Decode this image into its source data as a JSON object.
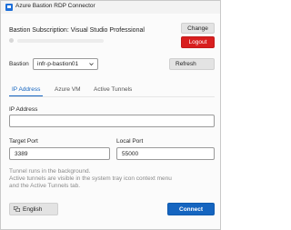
{
  "window": {
    "title": "Azure Bastion RDP Connector"
  },
  "subscription": {
    "prefix": "Bastion Subscription:",
    "name": "Visual Studio Professional"
  },
  "buttons": {
    "change": "Change",
    "logout": "Logout",
    "refresh": "Refresh",
    "connect": "Connect"
  },
  "bastion": {
    "label": "Bastion",
    "selected": "infr-p-bastion01"
  },
  "tabs": [
    {
      "label": "IP Address",
      "active": true
    },
    {
      "label": "Azure VM",
      "active": false
    },
    {
      "label": "Active Tunnels",
      "active": false
    }
  ],
  "form": {
    "ip_label": "IP Address",
    "ip_value": "",
    "target_port_label": "Target Port",
    "target_port_value": "3389",
    "local_port_label": "Local Port",
    "local_port_value": "55000"
  },
  "note": {
    "line1": "Tunnel runs in the background.",
    "line2": "Active tunnels are visible in the system tray icon context menu",
    "line3": "and the Active Tunnels tab."
  },
  "language": {
    "icon": "language-icon",
    "label": "English"
  },
  "colors": {
    "accent": "#1565c0",
    "danger": "#d81e1e"
  }
}
